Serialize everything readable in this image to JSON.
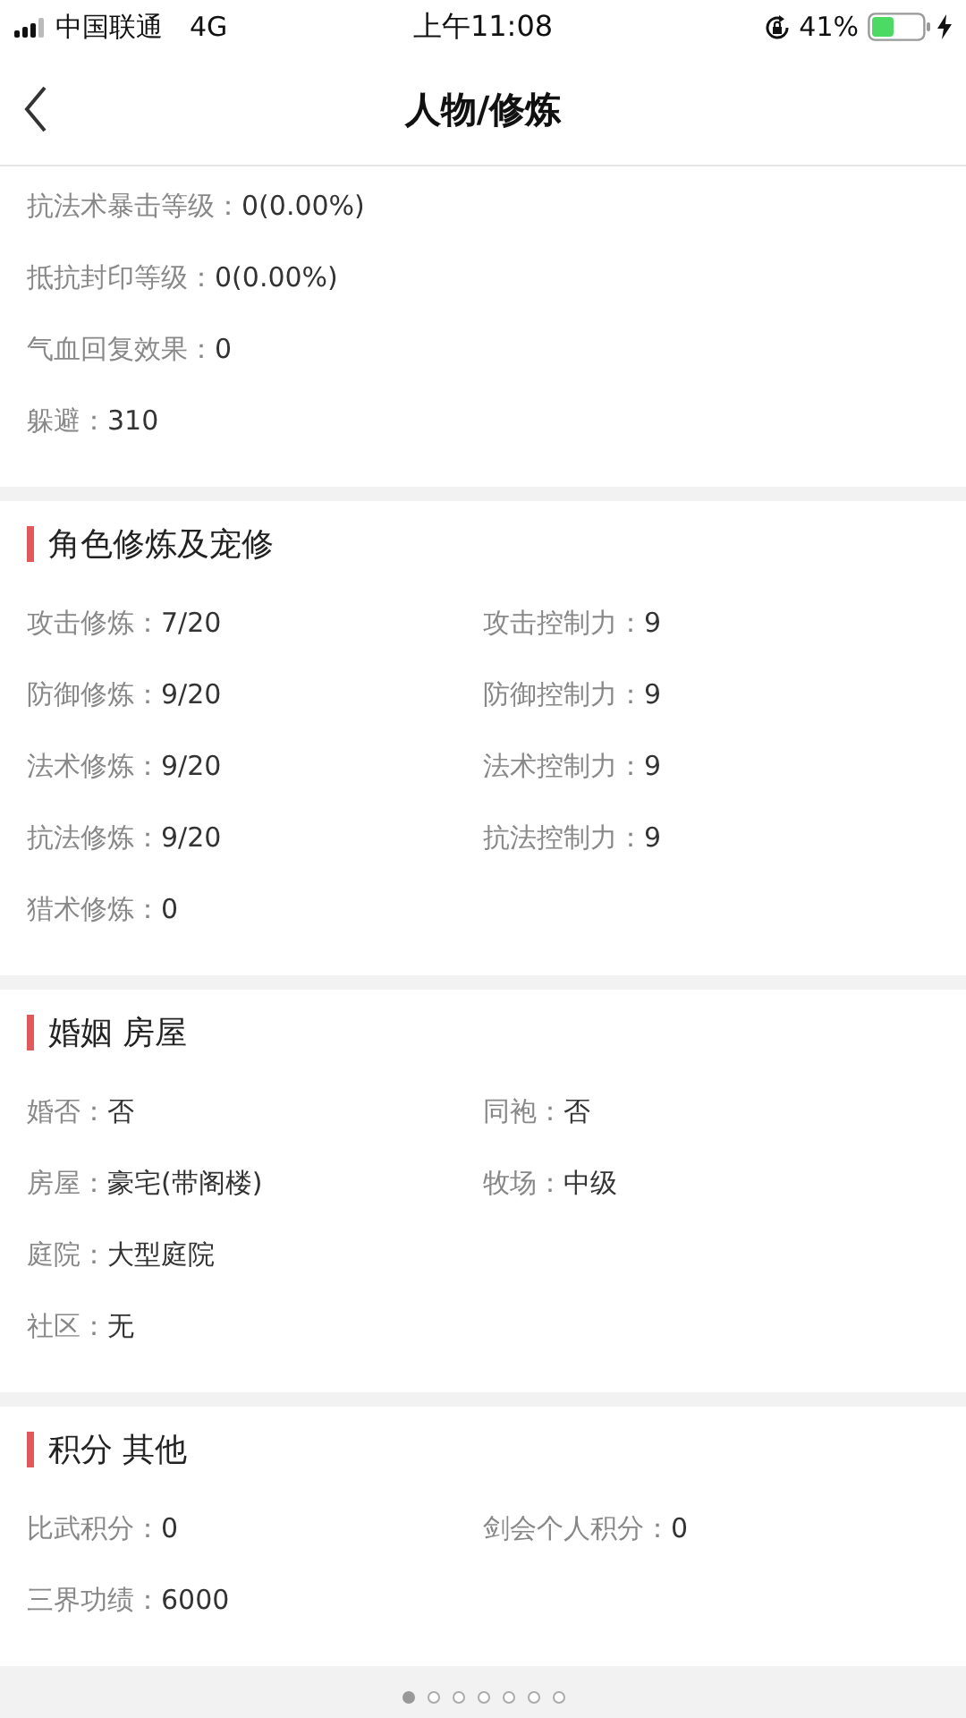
{
  "status_bar": {
    "carrier": "中国联通",
    "network": "4G",
    "time": "上午11:08",
    "battery_percent": "41%"
  },
  "nav": {
    "title": "人物/修炼"
  },
  "sections": [
    {
      "rows": [
        [
          {
            "label": "抗法术暴击等级：",
            "value": "0(0.00%)"
          }
        ],
        [
          {
            "label": "抵抗封印等级：",
            "value": "0(0.00%)"
          }
        ],
        [
          {
            "label": "气血回复效果：",
            "value": "0"
          }
        ],
        [
          {
            "label": "躲避：",
            "value": "310"
          }
        ]
      ]
    },
    {
      "title": "角色修炼及宠修",
      "rows": [
        [
          {
            "label": "攻击修炼：",
            "value": "7/20"
          },
          {
            "label": "攻击控制力：",
            "value": "9"
          }
        ],
        [
          {
            "label": "防御修炼：",
            "value": "9/20"
          },
          {
            "label": "防御控制力：",
            "value": "9"
          }
        ],
        [
          {
            "label": "法术修炼：",
            "value": "9/20"
          },
          {
            "label": "法术控制力：",
            "value": "9"
          }
        ],
        [
          {
            "label": "抗法修炼：",
            "value": "9/20"
          },
          {
            "label": "抗法控制力：",
            "value": "9"
          }
        ],
        [
          {
            "label": "猎术修炼：",
            "value": "0"
          }
        ]
      ]
    },
    {
      "title": "婚姻 房屋",
      "rows": [
        [
          {
            "label": "婚否：",
            "value": "否"
          },
          {
            "label": "同袍：",
            "value": "否"
          }
        ],
        [
          {
            "label": "房屋：",
            "value": "豪宅(带阁楼)"
          },
          {
            "label": "牧场：",
            "value": "中级"
          }
        ],
        [
          {
            "label": "庭院：",
            "value": "大型庭院"
          }
        ],
        [
          {
            "label": "社区：",
            "value": "无"
          }
        ]
      ]
    },
    {
      "title": "积分 其他",
      "rows": [
        [
          {
            "label": "比武积分：",
            "value": "0"
          },
          {
            "label": "剑会个人积分：",
            "value": "0"
          }
        ],
        [
          {
            "label": "三界功绩：",
            "value": "6000"
          }
        ]
      ]
    }
  ],
  "pager": [
    {
      "selected": true
    },
    {
      "selected": false
    },
    {
      "selected": false
    },
    {
      "selected": false
    },
    {
      "selected": false
    },
    {
      "selected": false
    },
    {
      "selected": false
    }
  ]
}
